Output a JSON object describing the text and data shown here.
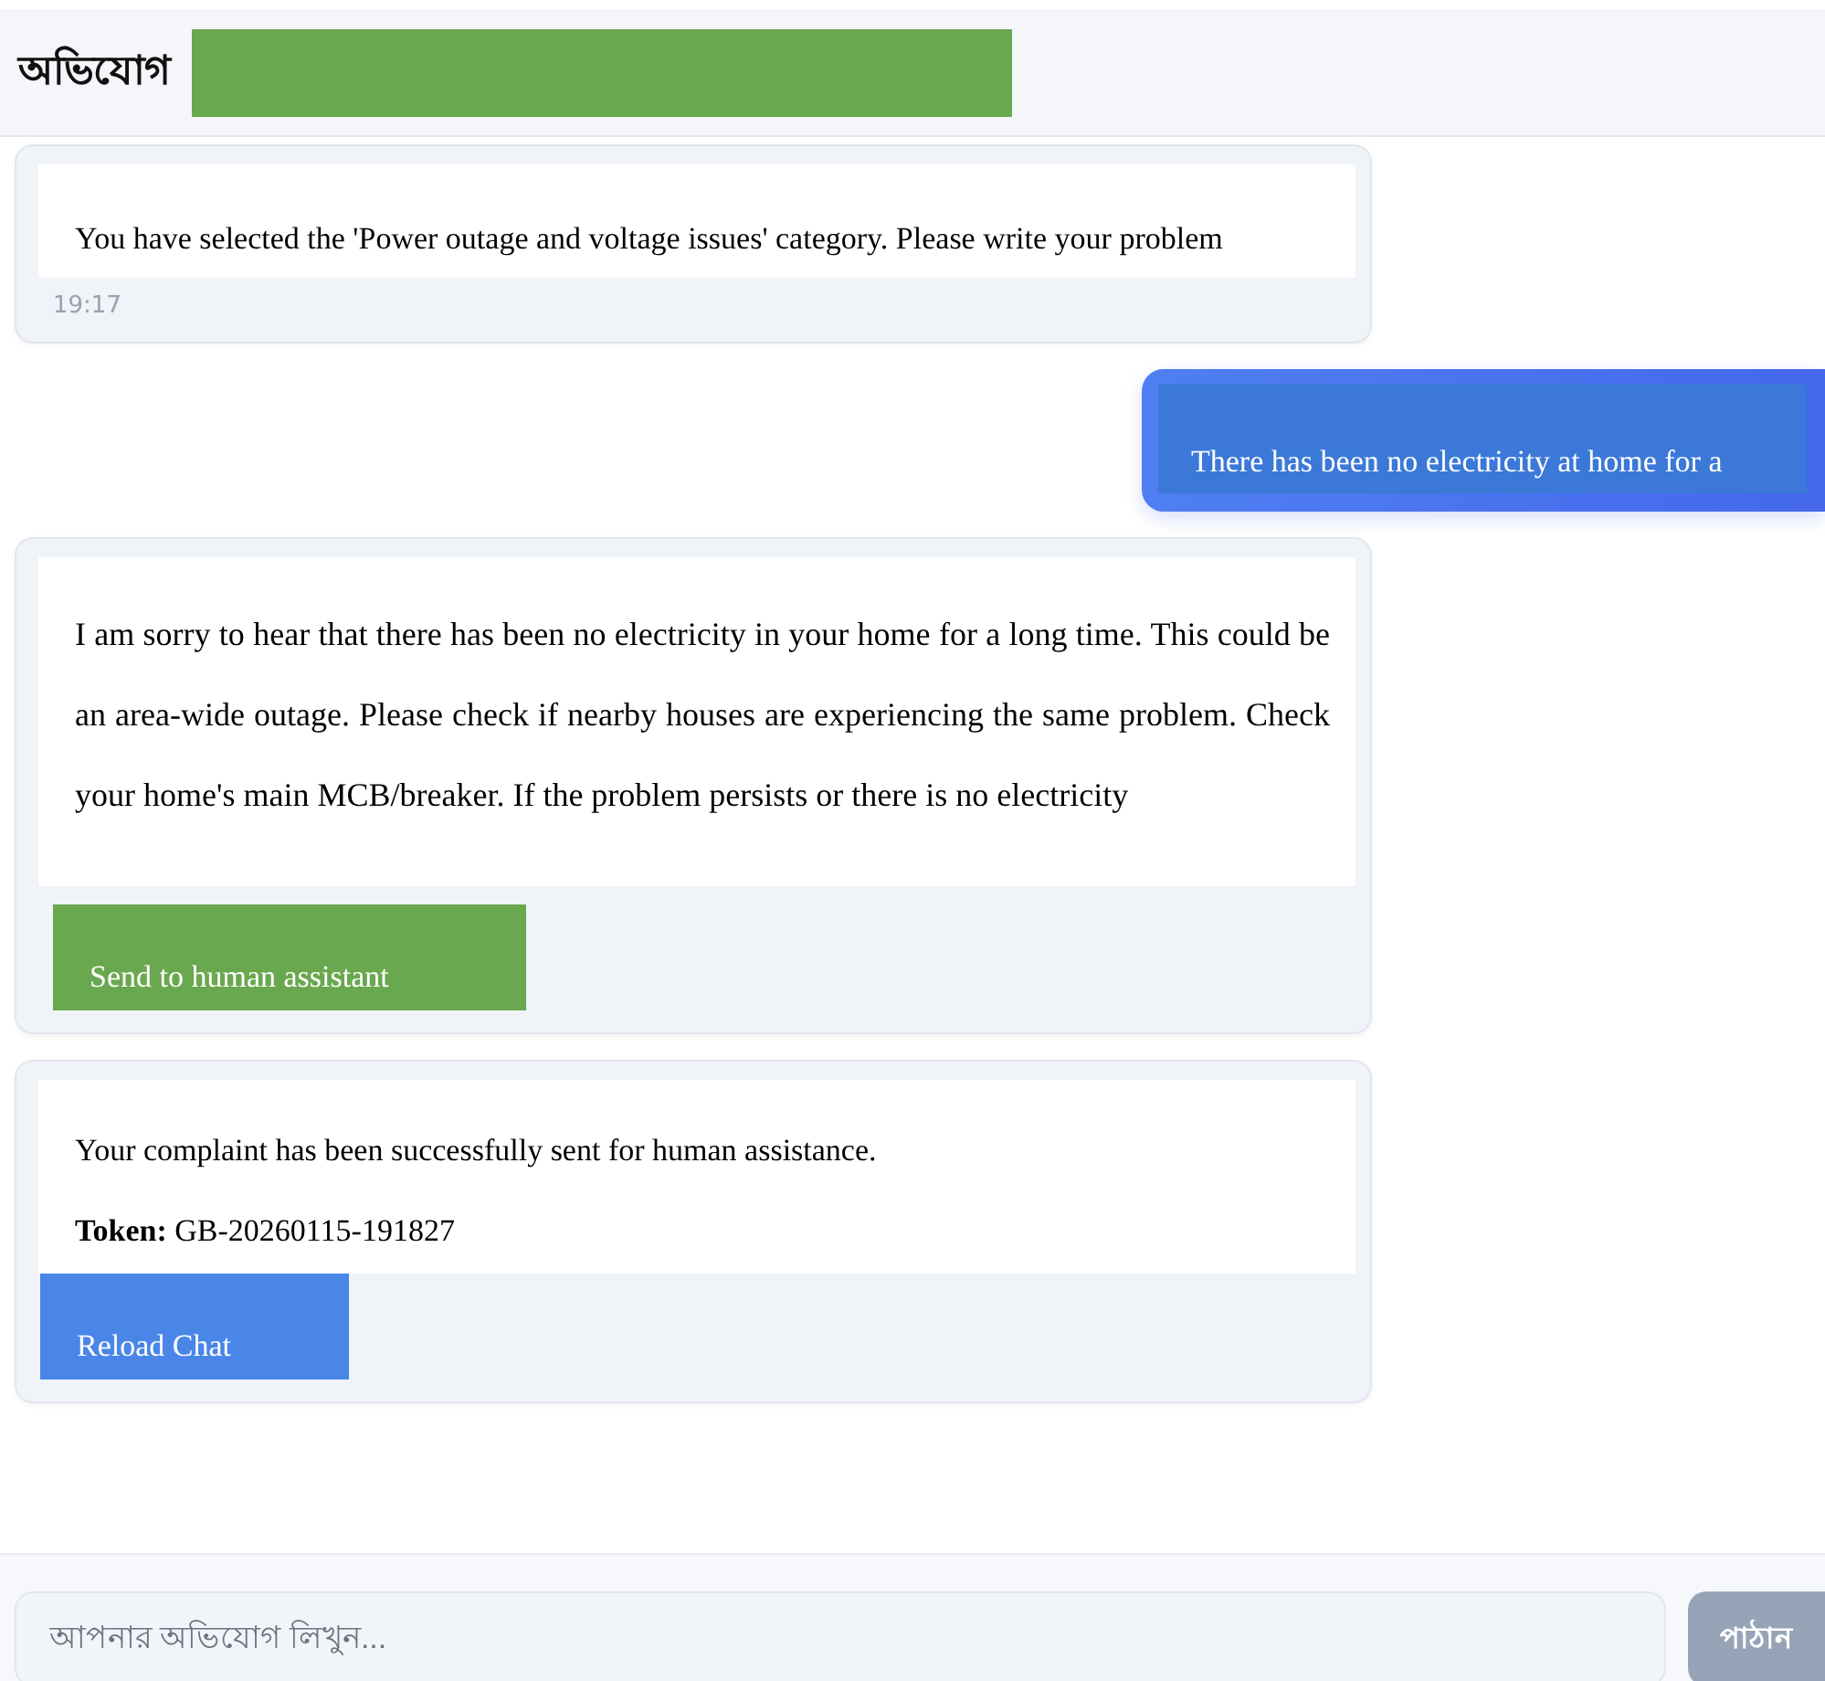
{
  "header": {
    "title": "অভিযোগ"
  },
  "messages": [
    {
      "kind": "bot",
      "paragraphs": [
        "You have selected the 'Power outage and voltage issues' category. Please write your problem"
      ],
      "time": "19:17"
    },
    {
      "kind": "user",
      "paragraphs": [
        "There has been no electricity at home for a"
      ]
    },
    {
      "kind": "bot",
      "paragraphs": [
        "I am sorry to hear that there has been no electricity in your home for a long time. This could be an area-wide outage. Please check if nearby houses are experiencing the same problem. Check your home's main MCB/breaker. If the problem persists or there is no electricity"
      ],
      "button": {
        "label": "Send to human assistant",
        "color": "#6aa84f"
      }
    },
    {
      "kind": "bot",
      "paragraphs": [
        "Your complaint has been successfully sent for human assistance.",
        "**Token:** GB-20260115-191827"
      ],
      "button": {
        "label": "Reload Chat",
        "color": "#4a86e8"
      }
    }
  ],
  "composer": {
    "placeholder": "আপনার অভিযোগ লিখুন...",
    "send_button": {
      "label": "পাঠান",
      "disabled": true
    }
  }
}
